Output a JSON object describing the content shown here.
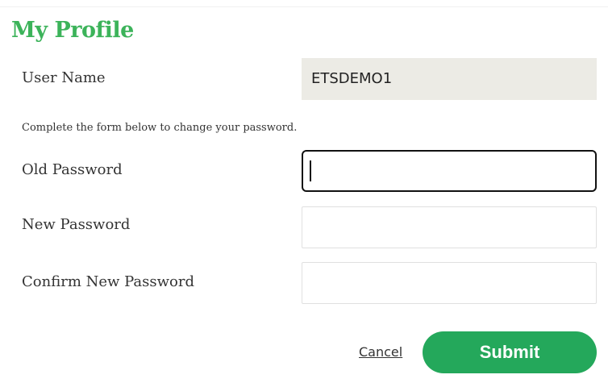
{
  "header": {
    "title": "My Profile"
  },
  "user": {
    "label": "User Name",
    "value": "ETSDEMO1"
  },
  "form": {
    "helper_text": "Complete the form below to change your password.",
    "old_password": {
      "label": "Old Password",
      "value": "",
      "state": "focused"
    },
    "new_password": {
      "label": "New Password",
      "value": ""
    },
    "confirm_password": {
      "label": "Confirm New Password",
      "value": ""
    }
  },
  "actions": {
    "cancel_label": "Cancel",
    "submit_label": "Submit"
  },
  "colors": {
    "title_green": "#3cb35a",
    "submit_green": "#24a85b",
    "readonly_bg": "#ecebe5"
  }
}
